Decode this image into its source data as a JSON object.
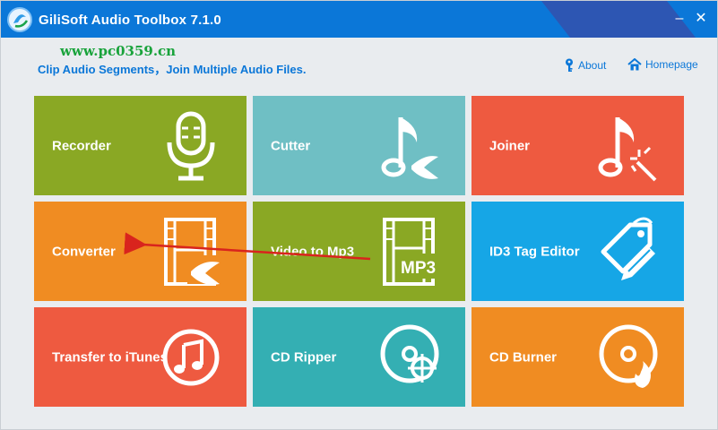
{
  "window": {
    "title": "GiliSoft Audio Toolbox 7.1.0",
    "minimize_glyph": "–",
    "close_glyph": "✕"
  },
  "watermark": {
    "text": "www.pc0359.cn"
  },
  "header": {
    "subtitle": "Clip Audio Segments，Join Multiple Audio Files.",
    "about_label": "About",
    "homepage_label": "Homepage"
  },
  "colors": {
    "titlebar": "#0b77d8",
    "accent": "#0b77d8",
    "green": "#8aa824",
    "teal": "#6fbfc4",
    "red": "#ee5a40",
    "orange": "#f08c22",
    "sky": "#16a6e6",
    "watermark": "#19a33b",
    "annotation_arrow": "#d9241d"
  },
  "tiles": [
    {
      "label": "Recorder",
      "icon": "microphone-icon"
    },
    {
      "label": "Cutter",
      "icon": "music-note-cut-icon"
    },
    {
      "label": "Joiner",
      "icon": "music-note-join-icon"
    },
    {
      "label": "Converter",
      "icon": "film-convert-icon"
    },
    {
      "label": "Video to Mp3",
      "icon": "film-mp3-icon",
      "icon_text": "MP3"
    },
    {
      "label": "ID3 Tag Editor",
      "icon": "tag-edit-icon"
    },
    {
      "label": "Transfer to iTunes",
      "icon": "itunes-icon"
    },
    {
      "label": "CD Ripper",
      "icon": "cd-rip-icon"
    },
    {
      "label": "CD Burner",
      "icon": "cd-burn-icon"
    }
  ]
}
